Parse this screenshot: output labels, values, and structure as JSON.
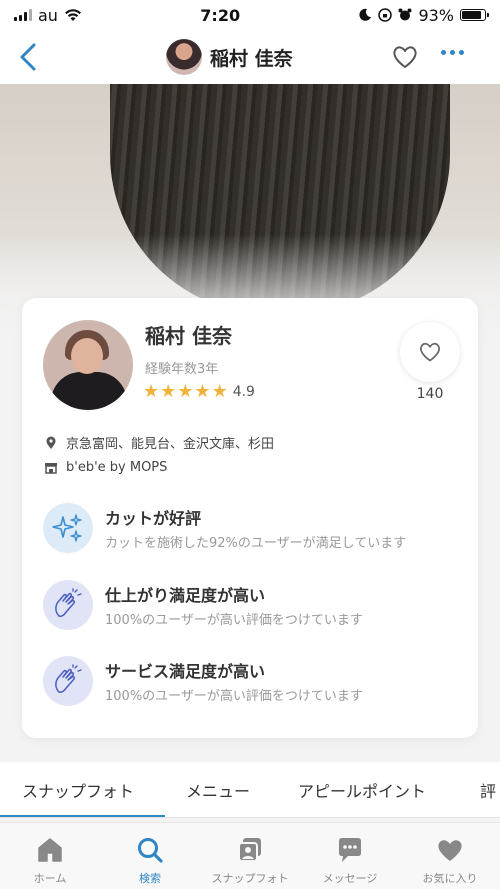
{
  "status_bar": {
    "carrier": "au",
    "time": "7:20",
    "battery": "93%"
  },
  "header": {
    "title": "稲村 佳奈"
  },
  "profile": {
    "name": "稲村 佳奈",
    "experience": "経験年数3年",
    "rating": "4.9",
    "rating_stars": 5,
    "favorites_count": "140",
    "stations": "京急富岡、能見台、金沢文庫、杉田",
    "salon": "b'eb'e by MOPS"
  },
  "features": [
    {
      "icon": "sparkle-icon",
      "title": "カットが好評",
      "description": "カットを施術した92%のユーザーが満足しています"
    },
    {
      "icon": "clapping-hands-icon",
      "title": "仕上がり満足度が高い",
      "description": "100%のユーザーが高い評価をつけています"
    },
    {
      "icon": "clapping-hands-icon",
      "title": "サービス満足度が高い",
      "description": "100%のユーザーが高い評価をつけています"
    }
  ],
  "tabs": [
    {
      "label": "スナップフォト",
      "active": true
    },
    {
      "label": "メニュー",
      "active": false
    },
    {
      "label": "アピールポイント",
      "active": false
    },
    {
      "label": "評",
      "active": false
    }
  ],
  "bottom_nav": [
    {
      "label": "ホーム",
      "icon": "home-icon",
      "active": false
    },
    {
      "label": "検索",
      "icon": "search-icon",
      "active": true
    },
    {
      "label": "スナップフォト",
      "icon": "photo-icon",
      "active": false
    },
    {
      "label": "メッセージ",
      "icon": "message-icon",
      "active": false
    },
    {
      "label": "お気に入り",
      "icon": "heart-icon",
      "active": false
    }
  ],
  "colors": {
    "accent": "#2f86c4",
    "star": "#f2b33d",
    "feature_bg_blue": "#dcebf7",
    "feature_bg_purple": "#e1e3f7"
  }
}
